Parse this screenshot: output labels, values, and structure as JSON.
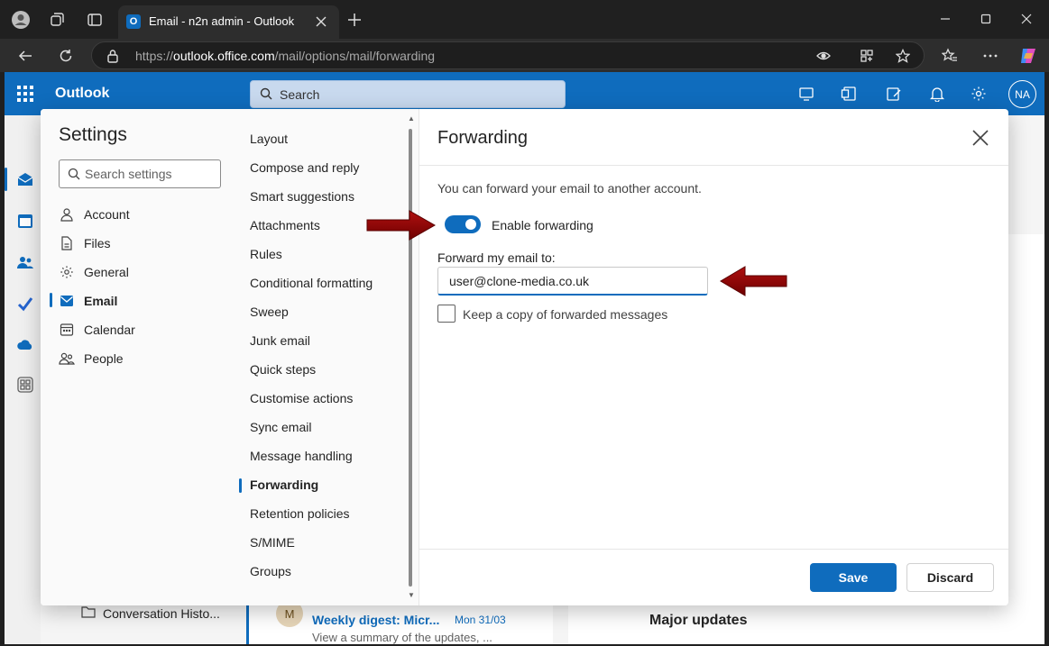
{
  "colors": {
    "accent": "#0f6cbd",
    "annotation_arrow": "#8b0000",
    "browser_bg": "#202020"
  },
  "browser": {
    "tab_title": "Email - n2n admin - Outlook",
    "url_scheme": "https://",
    "url_host": "outlook.office.com",
    "url_path": "/mail/options/mail/forwarding"
  },
  "header": {
    "app_name": "Outlook",
    "search_label": "Search",
    "avatar_initials": "NA"
  },
  "background": {
    "folder_name": "Conversation Histo...",
    "message_avatar": "M",
    "message_subject": "Weekly digest: Micr...",
    "message_date": "Mon 31/03",
    "message_preview": "View a summary of the updates, ...",
    "reading_heading": "Major updates"
  },
  "settings": {
    "title": "Settings",
    "search_placeholder": "Search settings",
    "categories": [
      {
        "label": "Account",
        "icon": "person-icon"
      },
      {
        "label": "Files",
        "icon": "file-icon"
      },
      {
        "label": "General",
        "icon": "gear-icon"
      },
      {
        "label": "Email",
        "icon": "mail-icon",
        "active": true
      },
      {
        "label": "Calendar",
        "icon": "calendar-icon"
      },
      {
        "label": "People",
        "icon": "people-icon"
      }
    ],
    "email_subsections": [
      "Layout",
      "Compose and reply",
      "Smart suggestions",
      "Attachments",
      "Rules",
      "Conditional formatting",
      "Sweep",
      "Junk email",
      "Quick steps",
      "Customise actions",
      "Sync email",
      "Message handling",
      "Forwarding",
      "Retention policies",
      "S/MIME",
      "Groups"
    ],
    "active_subsection": "Forwarding"
  },
  "forwarding": {
    "title": "Forwarding",
    "description": "You can forward your email to another account.",
    "toggle_label": "Enable forwarding",
    "toggle_on": true,
    "forward_to_label": "Forward my email to:",
    "forward_to_value": "user@clone-media.co.uk",
    "keep_copy_label": "Keep a copy of forwarded messages",
    "keep_copy_checked": false,
    "save_label": "Save",
    "discard_label": "Discard"
  }
}
